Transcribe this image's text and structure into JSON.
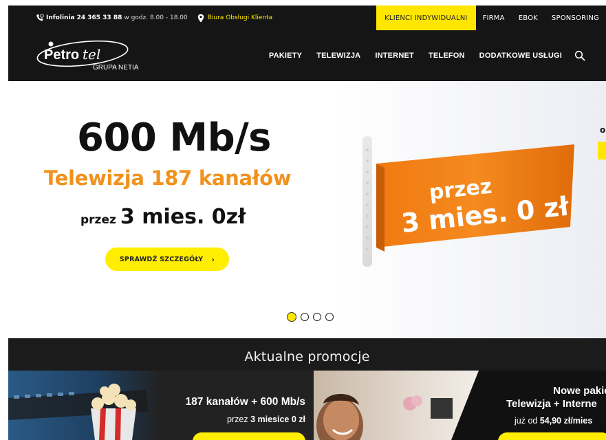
{
  "topbar": {
    "infolinia_label": "Infolinia",
    "infolinia_number": "24 365 33 88",
    "hours": "w godz. 8.00 - 18.00",
    "office_link": "Biura Obsługi Klienta",
    "segments": [
      {
        "label": "KLIENCI INDYWIDUALNI",
        "active": true
      },
      {
        "label": "FIRMA",
        "active": false
      },
      {
        "label": "EBOK",
        "active": false
      },
      {
        "label": "SPONSORING",
        "active": false
      }
    ]
  },
  "logo": {
    "brand": "Petrotel",
    "sub": "GRUPA NETIA"
  },
  "nav": {
    "items": [
      "PAKIETY",
      "TELEWIZJA",
      "INTERNET",
      "TELEFON",
      "DODATKOWE USŁUGI"
    ]
  },
  "hero": {
    "speed": "600 Mb/s",
    "tv": "Telewizja 187 kanałów",
    "offer_small": "przez",
    "offer_big": "3 mies. 0zł",
    "cta": "SPRAWDŹ SZCZEGÓŁY",
    "ribbon_line1": "przez",
    "ribbon_line2": "3 mies. 0 zł",
    "edge_text": "o",
    "slides_count": 4,
    "active_slide": 1
  },
  "promo": {
    "title": "Aktualne promocje",
    "card1": {
      "line1": "187 kanałów + 600 Mb/s",
      "line2_prefix": "przez",
      "line2_bold": "3 miesice 0 zł"
    },
    "card2": {
      "line1": "Nowe pakiety",
      "line2": "Telewizja + Interne",
      "line3_prefix": "już od",
      "line3_bold": "54,90 zł/mies"
    }
  },
  "colors": {
    "accent": "#ffe600",
    "orange": "#f0921e",
    "dark": "#151515"
  }
}
